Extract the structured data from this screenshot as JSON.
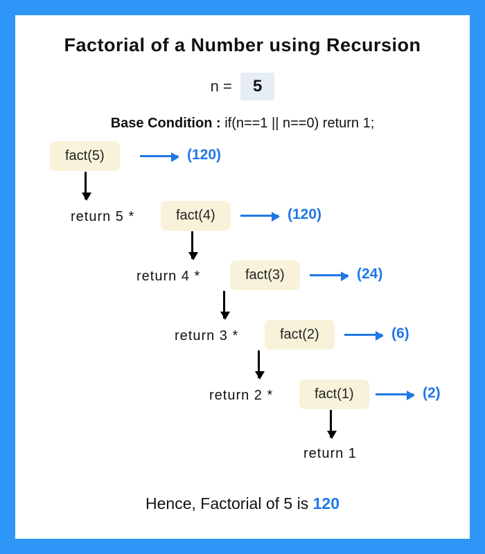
{
  "title": "Factorial of a Number using Recursion",
  "n_label": "n = ",
  "n_value": "5",
  "base_condition": {
    "label": "Base Condition : ",
    "code": "if(n==1 || n==0) return 1;"
  },
  "steps": [
    {
      "call": "fact(5)",
      "ret": "",
      "result": "(120)"
    },
    {
      "call": "fact(4)",
      "ret": "return  5 * ",
      "result": "(120)"
    },
    {
      "call": "fact(3)",
      "ret": "return  4 * ",
      "result": "(24)"
    },
    {
      "call": "fact(2)",
      "ret": "return  3 * ",
      "result": "(6)"
    },
    {
      "call": "fact(1)",
      "ret": "return  2 * ",
      "result": "(2)"
    }
  ],
  "final_return": "return 1",
  "conclusion_prefix": "Hence, Factorial of 5 is ",
  "conclusion_value": "120"
}
